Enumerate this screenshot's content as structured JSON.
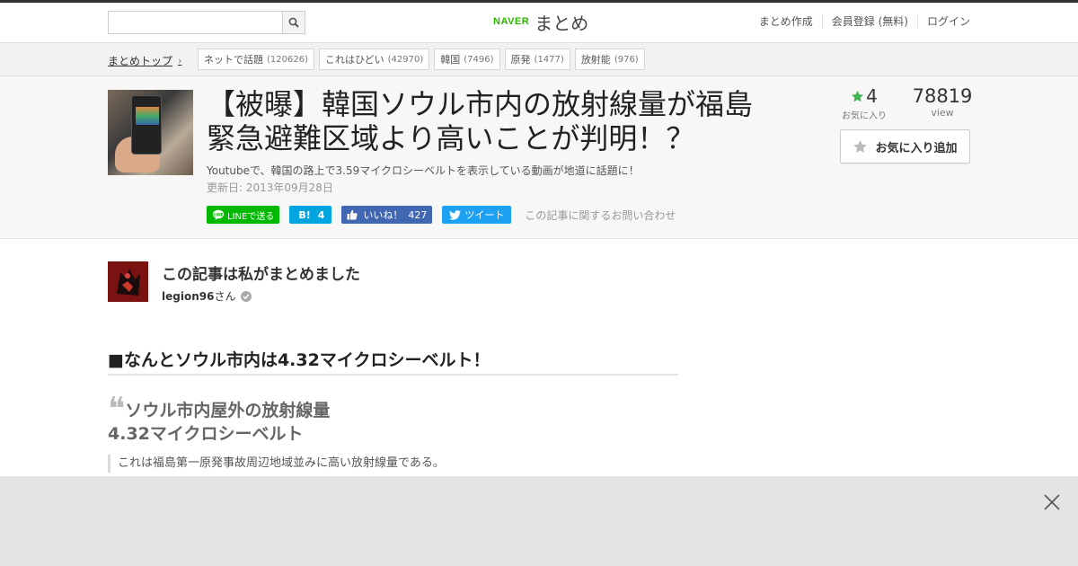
{
  "header": {
    "search_placeholder": "",
    "logo_naver": "NAVER",
    "logo_matome": "まとめ",
    "nav": [
      "まとめ作成",
      "会員登録 (無料)",
      "ログイン"
    ]
  },
  "breadcrumb": {
    "top": "まとめトップ"
  },
  "tags": [
    {
      "label": "ネットで話題",
      "count": "(120626)"
    },
    {
      "label": "これはひどい",
      "count": "(42970)"
    },
    {
      "label": "韓国",
      "count": "(7496)"
    },
    {
      "label": "原発",
      "count": "(1477)"
    },
    {
      "label": "放射能",
      "count": "(976)"
    }
  ],
  "article": {
    "title_line1": "【被曝】韓国ソウル市内の放射線量が福島",
    "title_line2": "緊急避難区域より高いことが判明！？",
    "description": "Youtubeで、韓国の路上で3.59マイクロシーベルトを表示している動画が地道に話題に！",
    "updated": "更新日: 2013年09月28日",
    "favorites": "4",
    "favorites_label": "お気に入り",
    "views": "78819",
    "views_label": "view",
    "fav_add_label": "お気に入り追加"
  },
  "share": {
    "line": "LINEで送る",
    "hatena_label": "B!",
    "hatena_count": "4",
    "fb_label": "いいね！",
    "fb_count": "427",
    "tweet": "ツイート",
    "inquiry": "この記事に関するお問い合わせ"
  },
  "author": {
    "heading": "この記事は私がまとめました",
    "name": "legion96",
    "suffix": "さん"
  },
  "content": {
    "section_title": "■なんとソウル市内は4.32マイクロシーベルト！",
    "quote_title": "ソウル市内屋外の放射線量",
    "quote_sub": "4.32マイクロシーベルト",
    "quote_text": "これは福島第一原発事故周辺地域並みに高い放射線量である。"
  },
  "colors": {
    "naver_green": "#2db400",
    "line_green": "#00b900",
    "hatena_blue": "#00a4de",
    "fb_blue": "#4267b2",
    "twitter_blue": "#1da1f2",
    "star_green": "#3cb44b"
  }
}
